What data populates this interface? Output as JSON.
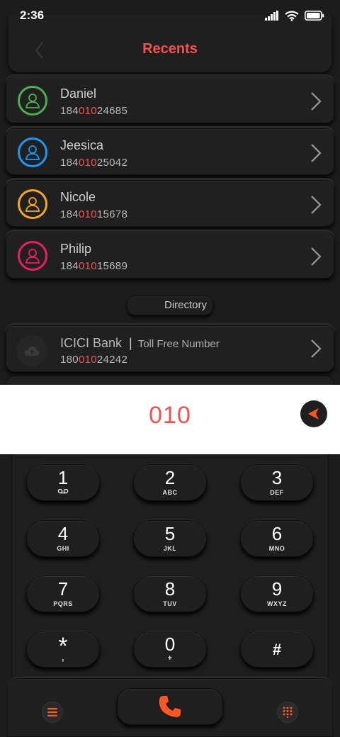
{
  "status": {
    "time": "2:36"
  },
  "header": {
    "title": "Recents"
  },
  "contacts": [
    {
      "name": "Daniel",
      "number_pre": "184",
      "number_match": "010",
      "number_post": "24685",
      "ring_color": "#4caf50"
    },
    {
      "name": "Jeesica",
      "number_pre": "184",
      "number_match": "010",
      "number_post": "25042",
      "ring_color": "#2196f3"
    },
    {
      "name": "Nicole",
      "number_pre": "184",
      "number_match": "010",
      "number_post": "15678",
      "ring_color": "#f5a623"
    },
    {
      "name": "Philip",
      "number_pre": "184",
      "number_match": "010",
      "number_post": "15689",
      "ring_color": "#e91e63"
    }
  ],
  "directory": {
    "label": "Directory",
    "entry": {
      "name": "ICICI Bank",
      "separator": "|",
      "tag": "Toll Free Number",
      "number_pre": "180",
      "number_match": "010",
      "number_post": "24242"
    }
  },
  "input": {
    "dialed": "010"
  },
  "keypad": [
    {
      "digit": "1",
      "letters": ""
    },
    {
      "digit": "2",
      "letters": "ABC"
    },
    {
      "digit": "3",
      "letters": "DEF"
    },
    {
      "digit": "4",
      "letters": "GHI"
    },
    {
      "digit": "5",
      "letters": "JKL"
    },
    {
      "digit": "6",
      "letters": "MNO"
    },
    {
      "digit": "7",
      "letters": "PQRS"
    },
    {
      "digit": "8",
      "letters": "TUV"
    },
    {
      "digit": "9",
      "letters": "WXYZ"
    },
    {
      "digit": "*",
      "letters": ","
    },
    {
      "digit": "0",
      "letters": "+"
    },
    {
      "digit": "#",
      "letters": ""
    }
  ],
  "colors": {
    "accent": "#ef5350",
    "call": "#ff5722",
    "background": "#1c1c1d"
  }
}
